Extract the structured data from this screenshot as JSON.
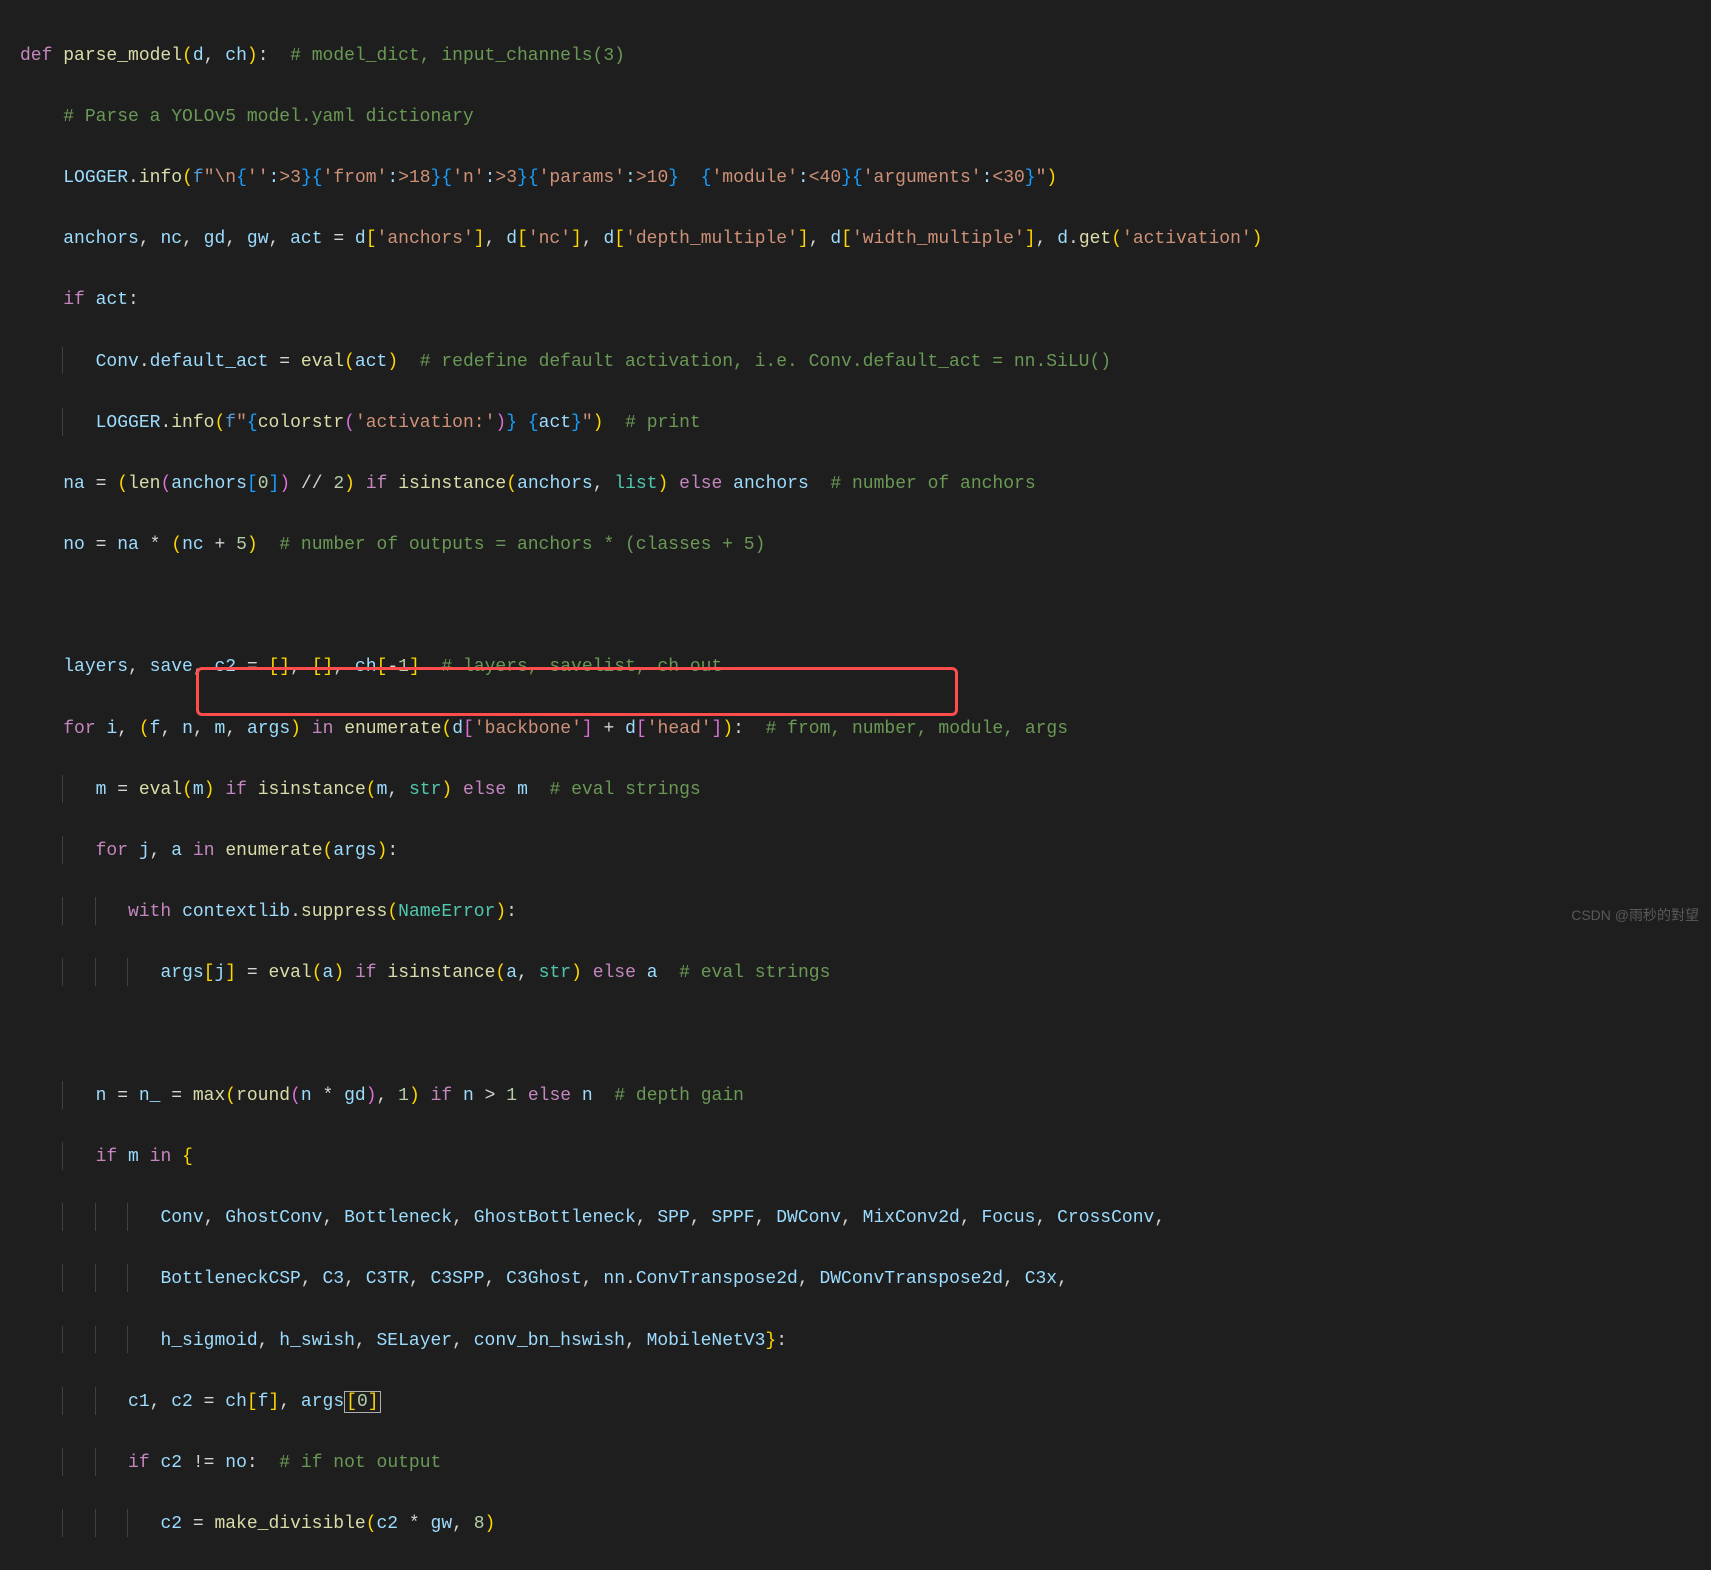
{
  "lines": {
    "l1": {
      "def": "def",
      "fn": "parse_model",
      "args": "(d, ch):",
      "cmt": "# model_dict, input_channels(3)"
    },
    "l2": {
      "cmt": "# Parse a YOLOv5 model.yaml dictionary"
    },
    "l3": {
      "logger": "LOGGER",
      "info": ".info(",
      "f": "f",
      "s1": "\"\\n",
      "b1": "{",
      "s2": "''",
      "s3": ":>3",
      "b2": "}{",
      "s4": "'from'",
      "s5": ":>18",
      "b3": "}{",
      "s6": "'n'",
      "s7": ":>3",
      "b4": "}{",
      "s8": "'params'",
      "s9": ":>10",
      "b5": "}",
      "sp": "  ",
      "b6": "{",
      "s10": "'module'",
      "s11": ":<40",
      "b7": "}{",
      "s12": "'arguments'",
      "s13": ":<30",
      "b8": "}",
      "s14": "\"",
      "close": ")"
    },
    "l4": {
      "anchors": "anchors",
      "nc": "nc",
      "gd": "gd",
      "gw": "gw",
      "act": "act",
      "eq": " = ",
      "d1": "d[",
      "s1": "'anchors'",
      "c1": "], ",
      "d2": "d[",
      "s2": "'nc'",
      "c2": "], ",
      "d3": "d[",
      "s3": "'depth_multiple'",
      "c3": "], ",
      "d4": "d[",
      "s4": "'width_multiple'",
      "c4": "], ",
      "d5": "d.get(",
      "s5": "'activation'",
      "c5": ")"
    },
    "l5": {
      "if": "if",
      "act": "act",
      "colon": ":"
    },
    "l6": {
      "conv": "Conv",
      "dot": ".",
      "da": "default_act",
      "eq": " = ",
      "eval": "eval",
      "pa": "(act)",
      "cmt": "# redefine default activation, i.e. Conv.default_act = nn.SiLU()"
    },
    "l7": {
      "logger": "LOGGER",
      "info": ".info(",
      "f": "f",
      "q1": "\"",
      "b1": "{",
      "colorstr": "colorstr(",
      "s1": "'activation:'",
      "cp": ")",
      "b2": "}",
      "sp": " ",
      "b3": "{",
      "act": "act",
      "b4": "}",
      "q2": "\"",
      "close": ")",
      "cmt": "# print"
    },
    "l8": {
      "na": "na",
      "eq": " = (",
      "len": "len",
      "p1": "(anchors[",
      "num0": "0",
      "p2": "]) // ",
      "num2": "2",
      "p3": ") ",
      "if": "if",
      "sp": " ",
      "isinstance": "isinstance",
      "p4": "(anchors, ",
      "list": "list",
      "p5": ") ",
      "else": "else",
      "anchors": " anchors",
      "cmt": "# number of anchors"
    },
    "l9": {
      "no": "no",
      "eq": " = na * (nc + ",
      "num5": "5",
      "close": ")",
      "cmt": "# number of outputs = anchors * (classes + 5)"
    },
    "l10": {
      "layers": "layers",
      "save": "save",
      "c2": "c2",
      "eq": " = [], [], ch[-",
      "num1": "1",
      "close": "]",
      "cmt": "# layers, savelist, ch out"
    },
    "l11": {
      "for": "for",
      "i": "i",
      "c": ", (",
      "f": "f",
      "n": "n",
      "m": "m",
      "args": "args",
      "c2": ") ",
      "in": "in",
      "sp": " ",
      "enum": "enumerate",
      "p1": "(d[",
      "s1": "'backbone'",
      "p2": "] + d[",
      "s2": "'head'",
      "p3": "]):",
      "cmt": "# from, number, module, args"
    },
    "l12": {
      "m": "m",
      "eq": " = ",
      "eval": "eval",
      "p1": "(m) ",
      "if": "if",
      "sp": " ",
      "isi": "isinstance",
      "p2": "(m, ",
      "str": "str",
      "p3": ") ",
      "else": "else",
      "m2": " m",
      "cmt": "# eval strings"
    },
    "l13": {
      "for": "for",
      "j": " j",
      "c": ", ",
      "a": "a",
      "sp": " ",
      "in": "in",
      "sp2": " ",
      "enum": "enumerate",
      "p1": "(args):"
    },
    "l14": {
      "with": "with",
      "ctx": " contextlib.suppress(",
      "ne": "NameError",
      "close": "):"
    },
    "l15": {
      "args": "args[j]",
      "eq": " = ",
      "eval": "eval",
      "p1": "(a) ",
      "if": "if",
      "sp": " ",
      "isi": "isinstance",
      "p2": "(a, ",
      "str": "str",
      "p3": ") ",
      "else": "else",
      "a": " a",
      "cmt": "# eval strings"
    },
    "l16": {
      "n": "n",
      "eq": " = ",
      "n_": "n_",
      "eq2": " = ",
      "max": "max",
      "p1": "(",
      "round": "round",
      "p2": "(n * gd), ",
      "num1": "1",
      "p3": ") ",
      "if": "if",
      "cond": " n > ",
      "num1b": "1",
      "sp": " ",
      "else": "else",
      "n2": " n",
      "cmt": "# depth gain"
    },
    "l17": {
      "if": "if",
      "m": " m ",
      "in": "in",
      "brace": " {"
    },
    "l18": {
      "items": "Conv, GhostConv, Bottleneck, GhostBottleneck, SPP, SPPF, DWConv, MixConv2d, Focus, CrossConv,"
    },
    "l19": {
      "items": "BottleneckCSP, C3, C3TR, C3SPP, C3Ghost, nn.ConvTranspose2d, DWConvTranspose2d, C3x,"
    },
    "l20": {
      "items": "h_sigmoid, h_swish, SELayer, conv_bn_hswish, MobileNetV3",
      "close": "}:"
    },
    "l21": {
      "c1": "c1",
      "c": ", ",
      "c2": "c2",
      "eq": " = ch[f], args",
      "b0a": "[",
      "num0": "0",
      "b0b": "]"
    },
    "l22": {
      "if": "if",
      "c2": " c2 != no:",
      "cmt": "# if not output"
    },
    "l23": {
      "c2": "c2",
      "eq": " = ",
      "md": "make_divisible",
      "p1": "(c2 * gw, ",
      "num8": "8",
      "p2": ")"
    }
  },
  "watermark": "CSDN @雨秒的對望"
}
